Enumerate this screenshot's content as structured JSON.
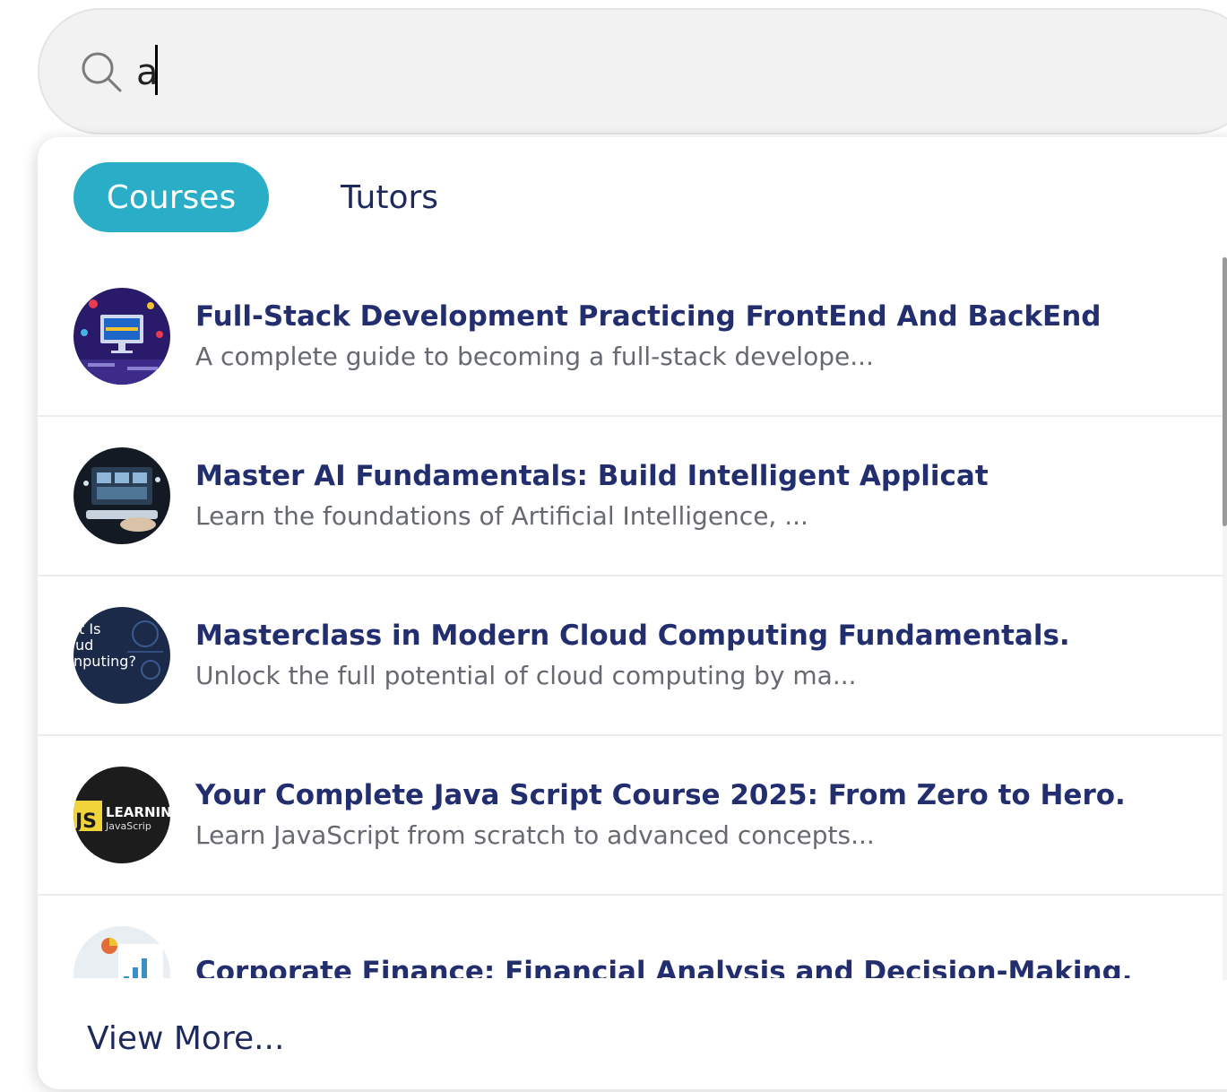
{
  "search": {
    "value": "a",
    "icon": "search-icon"
  },
  "tabs": [
    {
      "label": "Courses",
      "active": true
    },
    {
      "label": "Tutors",
      "active": false
    }
  ],
  "colors": {
    "accent": "#2aaec7",
    "title": "#232e6e",
    "description": "#666a70"
  },
  "results": [
    {
      "title": "Full-Stack Development Practicing FrontEnd And BackEnd",
      "description": "A complete guide to becoming a full-stack develope..."
    },
    {
      "title": "Master AI Fundamentals: Build Intelligent Applicat",
      "description": "Learn the foundations of Artificial Intelligence, ..."
    },
    {
      "title": "Masterclass in Modern Cloud Computing Fundamentals.",
      "description": "Unlock the full potential of cloud computing by ma..."
    },
    {
      "title": "Your Complete Java Script Course 2025: From Zero to Hero.",
      "description": "Learn JavaScript from scratch to advanced concepts..."
    },
    {
      "title": "Corporate Finance: Financial Analysis and Decision-Making.",
      "description": ""
    }
  ],
  "thumb_text": {
    "cloud": [
      "t Is",
      "ud",
      "nputing?"
    ],
    "js_badge": "JS",
    "js_word": "LEARNIN",
    "js_sub": "JavaScrip"
  },
  "view_more": "View More..."
}
